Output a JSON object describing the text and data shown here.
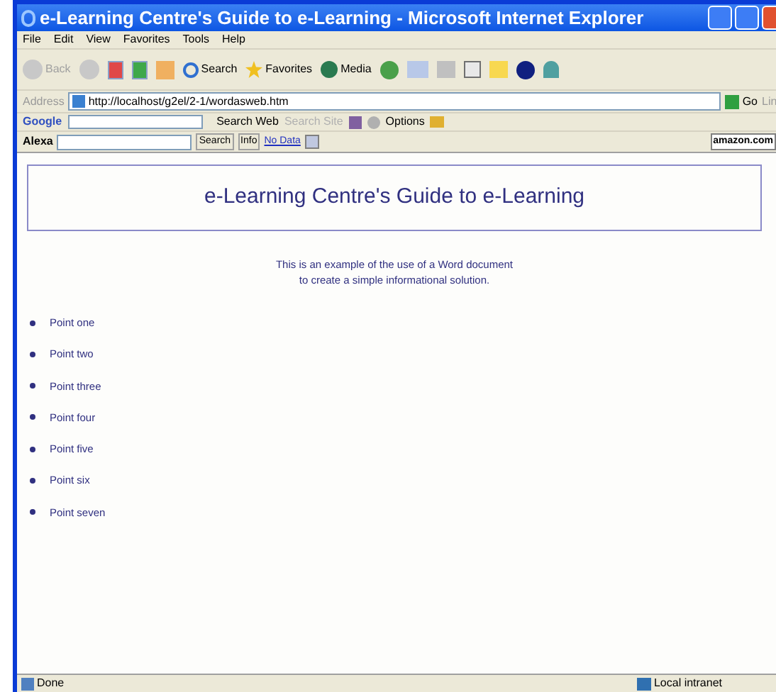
{
  "window": {
    "title": "e-Learning Centre's Guide to e-Learning - Microsoft Internet Explorer"
  },
  "menu": [
    "File",
    "Edit",
    "View",
    "Favorites",
    "Tools",
    "Help"
  ],
  "toolbar": {
    "back": "Back",
    "search": "Search",
    "favorites": "Favorites",
    "media": "Media"
  },
  "address": {
    "label": "Address",
    "url": "http://localhost/g2el/2-1/wordasweb.htm",
    "go": "Go",
    "links": "Lin"
  },
  "google_bar": {
    "logo": "Google",
    "search_web": "Search Web",
    "search_site": "Search Site",
    "options": "Options"
  },
  "alexa_bar": {
    "logo": "Alexa",
    "search": "Search",
    "info": "Info",
    "no_data": "No Data",
    "amazon": "amazon.com"
  },
  "page": {
    "heading": "e-Learning Centre's Guide to e-Learning",
    "intro": [
      "This is an example of the use of a Word document",
      "to create a simple informational solution."
    ],
    "points": [
      "Point one",
      "Point two",
      "Point three",
      "Point four",
      "Point five",
      "Point six",
      "Point seven"
    ]
  },
  "status_bar": {
    "text": "Done",
    "zone": "Local intranet"
  }
}
